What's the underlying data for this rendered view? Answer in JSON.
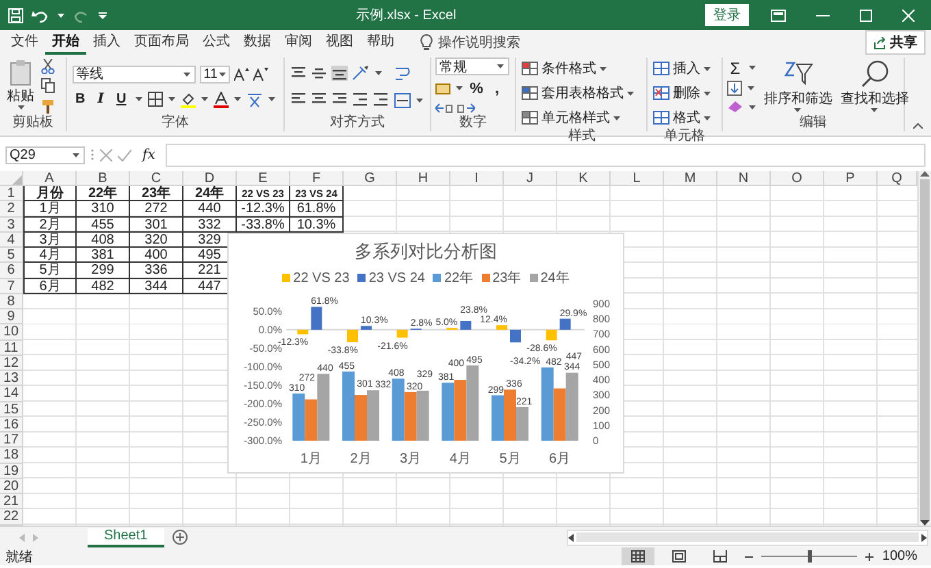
{
  "title_bar": {
    "title": "示例.xlsx  -  Excel",
    "sign_in": "登录"
  },
  "ribbon_tabs": [
    {
      "label": "文件",
      "selected": false
    },
    {
      "label": "开始",
      "selected": true
    },
    {
      "label": "插入",
      "selected": false
    },
    {
      "label": "页面布局",
      "selected": false
    },
    {
      "label": "公式",
      "selected": false
    },
    {
      "label": "数据",
      "selected": false
    },
    {
      "label": "审阅",
      "selected": false
    },
    {
      "label": "视图",
      "selected": false
    },
    {
      "label": "帮助",
      "selected": false
    }
  ],
  "tell_me": {
    "placeholder": "操作说明搜索"
  },
  "share": "共享",
  "ribbon": {
    "clipboard": {
      "paste": "粘贴",
      "label": "剪贴板"
    },
    "font": {
      "name": "等线",
      "size": "11",
      "styles": [
        "B",
        "I",
        "U"
      ],
      "label": "字体"
    },
    "alignment": {
      "label": "对齐方式"
    },
    "number": {
      "format": "常规",
      "symbols": [
        "%",
        ","
      ],
      "label": "数字"
    },
    "styles": {
      "items": [
        "条件格式",
        "套用表格格式",
        "单元格样式"
      ],
      "label": "样式"
    },
    "cells": {
      "items": [
        "插入",
        "删除",
        "格式"
      ],
      "label": "单元格"
    },
    "editing": {
      "sum": "Σ",
      "items": [
        "排序和筛选",
        "查找和选择"
      ],
      "label": "编辑"
    }
  },
  "formula_bar": {
    "name_box": "Q29",
    "fx": "fx"
  },
  "sheet": {
    "columns": [
      "A",
      "B",
      "C",
      "D",
      "E",
      "F",
      "G",
      "H",
      "I",
      "J",
      "K",
      "L",
      "M",
      "N",
      "O",
      "P",
      "Q"
    ],
    "rows": [
      {
        "number": "1",
        "kind": "header",
        "cells": [
          "月份",
          "22年",
          "23年",
          "24年",
          "22 VS 23",
          "23 VS 24"
        ]
      },
      {
        "number": "2",
        "kind": "data",
        "cells": [
          "1月",
          "310",
          "272",
          "440",
          "-12.3%",
          "61.8%"
        ]
      },
      {
        "number": "3",
        "kind": "data",
        "cells": [
          "2月",
          "455",
          "301",
          "332",
          "-33.8%",
          "10.3%"
        ]
      },
      {
        "number": "4",
        "kind": "data",
        "cells": [
          "3月",
          "408",
          "320",
          "329"
        ]
      },
      {
        "number": "5",
        "kind": "data",
        "cells": [
          "4月",
          "381",
          "400",
          "495"
        ]
      },
      {
        "number": "6",
        "kind": "data",
        "cells": [
          "5月",
          "299",
          "336",
          "221"
        ]
      },
      {
        "number": "7",
        "kind": "data",
        "cells": [
          "6月",
          "482",
          "344",
          "447"
        ]
      },
      {
        "number": "8"
      },
      {
        "number": "9"
      },
      {
        "number": "10"
      },
      {
        "number": "11"
      },
      {
        "number": "12"
      },
      {
        "number": "13"
      },
      {
        "number": "14"
      },
      {
        "number": "15"
      },
      {
        "number": "16"
      },
      {
        "number": "17"
      },
      {
        "number": "18"
      },
      {
        "number": "19"
      },
      {
        "number": "20"
      },
      {
        "number": "21"
      },
      {
        "number": "22"
      }
    ]
  },
  "chart": {
    "chart_data": {
      "type": "bar",
      "title": "多系列对比分析图",
      "legend": true,
      "categories": [
        "1月",
        "2月",
        "3月",
        "4月",
        "5月",
        "6月"
      ],
      "series": [
        {
          "name": "22 VS 23",
          "color": "#ffc000",
          "values": [
            -0.123,
            -0.338,
            -0.216,
            0.05,
            0.124,
            -0.286
          ],
          "value_labels": [
            "-12.3%",
            "-33.8%",
            "-21.6%",
            "5.0%",
            "12.4%",
            "-28.6%"
          ]
        },
        {
          "name": "23 VS 24",
          "color": "#4472c4",
          "values": [
            0.618,
            0.103,
            0.028,
            0.238,
            -0.342,
            0.299
          ],
          "value_labels": [
            "61.8%",
            "10.3%",
            "2.8%",
            "23.8%",
            "-34.2%",
            "29.9%"
          ]
        },
        {
          "name": "22年",
          "color": "#5b9bd5",
          "axis": "y2",
          "values": [
            310,
            455,
            408,
            381,
            299,
            482
          ],
          "value_labels": [
            "310",
            "455",
            "408",
            "381",
            "299",
            "482"
          ]
        },
        {
          "name": "23年",
          "color": "#ed7d31",
          "axis": "y2",
          "values": [
            272,
            301,
            320,
            400,
            336,
            344
          ],
          "value_labels": [
            "272",
            "301",
            "320",
            "400",
            "336",
            "344"
          ]
        },
        {
          "name": "24年",
          "color": "#a5a5a5",
          "axis": "y2",
          "values": [
            440,
            332,
            329,
            495,
            221,
            447
          ],
          "value_labels": [
            "440",
            "332",
            "329",
            "495",
            "221",
            "447"
          ]
        }
      ],
      "ylim": [
        -3,
        0.7
      ],
      "yticks": [
        {
          "value": 0.5,
          "label": "50.0%"
        },
        {
          "value": 0,
          "label": "0.0%"
        },
        {
          "value": -0.5,
          "label": "-50.0%"
        },
        {
          "value": -1,
          "label": "-100.0%"
        },
        {
          "value": -1.5,
          "label": "-150.0%"
        },
        {
          "value": -2,
          "label": "-200.0%"
        },
        {
          "value": -2.5,
          "label": "-250.0%"
        },
        {
          "value": -3,
          "label": "-300.0%"
        }
      ],
      "y2lim": [
        0,
        900
      ],
      "y2ticks": [
        900,
        800,
        700,
        600,
        500,
        400,
        300,
        200,
        100,
        0
      ]
    }
  },
  "sheet_tabs": [
    {
      "label": "Sheet1",
      "selected": true
    }
  ],
  "status_bar": {
    "status": "就绪",
    "views": [
      {
        "kind": "normal",
        "selected": true
      },
      {
        "kind": "page_layout",
        "selected": false
      },
      {
        "kind": "page_break",
        "selected": false
      }
    ],
    "zoom": {
      "level": 0.5,
      "reading": "100%"
    }
  }
}
